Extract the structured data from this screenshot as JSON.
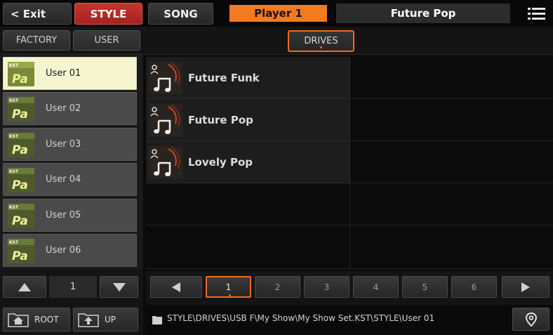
{
  "topbar": {
    "exit_label": "< Exit",
    "style_label": "STYLE",
    "song_label": "SONG",
    "player_label": "Player 1",
    "song_name": "Future Pop"
  },
  "subbar": {
    "factory_label": "FACTORY",
    "user_label": "USER",
    "drives_label": "DRIVES"
  },
  "left_list": {
    "items": [
      {
        "label": "User 01",
        "selected": true
      },
      {
        "label": "User 02",
        "selected": false
      },
      {
        "label": "User 03",
        "selected": false
      },
      {
        "label": "User 04",
        "selected": false
      },
      {
        "label": "User 05",
        "selected": false
      },
      {
        "label": "User 06",
        "selected": false
      }
    ],
    "icon_badge": "KST",
    "icon_text": "Pa",
    "page_value": "1"
  },
  "grid": {
    "items": [
      "Future Funk",
      "Future Pop",
      "Lovely Pop"
    ]
  },
  "pager": {
    "pages": [
      "1",
      "2",
      "3",
      "4",
      "5",
      "6"
    ],
    "active_page": "1"
  },
  "bottom": {
    "root_label": "ROOT",
    "up_label": "UP",
    "path": "STYLE\\DRIVES\\USB F\\My Show\\My Show Set.KST\\STYLE\\User 01"
  },
  "colors": {
    "accent_orange": "#f26a1b",
    "style_red": "#c8332c",
    "selected_row": "#f4f4cf"
  },
  "icons": [
    "menu-icon",
    "folder-pa-icon",
    "style-note-icon",
    "arrow-up-icon",
    "arrow-down-icon",
    "arrow-left-icon",
    "arrow-right-icon",
    "home-folder-icon",
    "up-folder-icon",
    "path-folder-icon",
    "location-pin-icon"
  ]
}
